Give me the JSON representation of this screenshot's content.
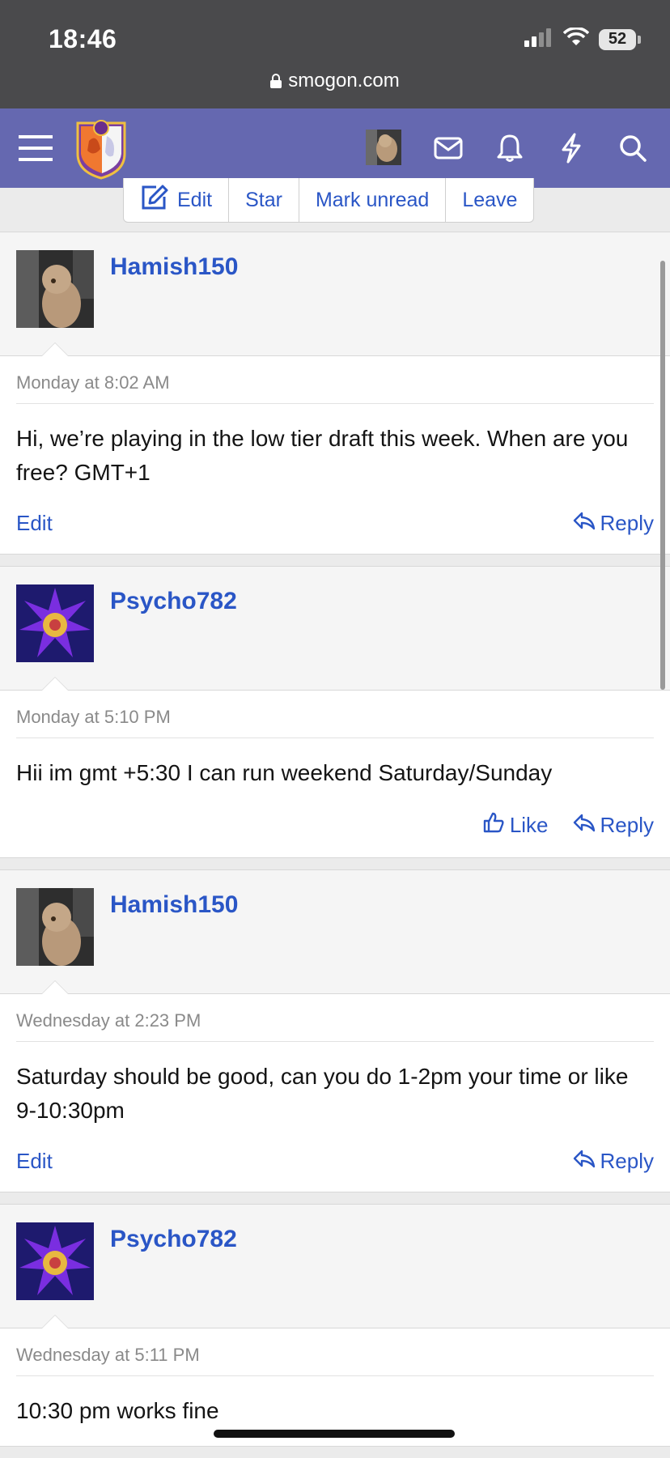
{
  "status_bar": {
    "time": "18:46",
    "battery": "52",
    "url": "smogon.com"
  },
  "header": {
    "icons": [
      "menu-icon",
      "site-logo",
      "user-avatar",
      "inbox-icon",
      "alerts-icon",
      "whats-new-icon",
      "search-icon"
    ],
    "brand_color": "#6568b0"
  },
  "thread_actions": {
    "edit": "Edit",
    "star": "Star",
    "mark_unread": "Mark unread",
    "leave": "Leave"
  },
  "messages": [
    {
      "author": "Hamish150",
      "avatar": "dog-photo",
      "date": "Monday at 8:02 AM",
      "text": "Hi, we’re playing in the low tier draft this week. When are you free? GMT+1",
      "left_action": "Edit",
      "reply": "Reply"
    },
    {
      "author": "Psycho782",
      "avatar": "starmie-art",
      "date": "Monday at 5:10 PM",
      "text": "Hii im gmt +5:30 I can run weekend Saturday/Sunday",
      "left_action": "Like",
      "reply": "Reply"
    },
    {
      "author": "Hamish150",
      "avatar": "dog-photo",
      "date": "Wednesday at 2:23 PM",
      "text": "Saturday should be good, can you do 1-2pm your time or like 9-10:30pm",
      "left_action": "Edit",
      "reply": "Reply"
    },
    {
      "author": "Psycho782",
      "avatar": "starmie-art",
      "date": "Wednesday at 5:11 PM",
      "text": "10:30 pm works fine"
    }
  ],
  "colors": {
    "link": "#2a56c6",
    "status_bar": "#4a4a4c"
  }
}
